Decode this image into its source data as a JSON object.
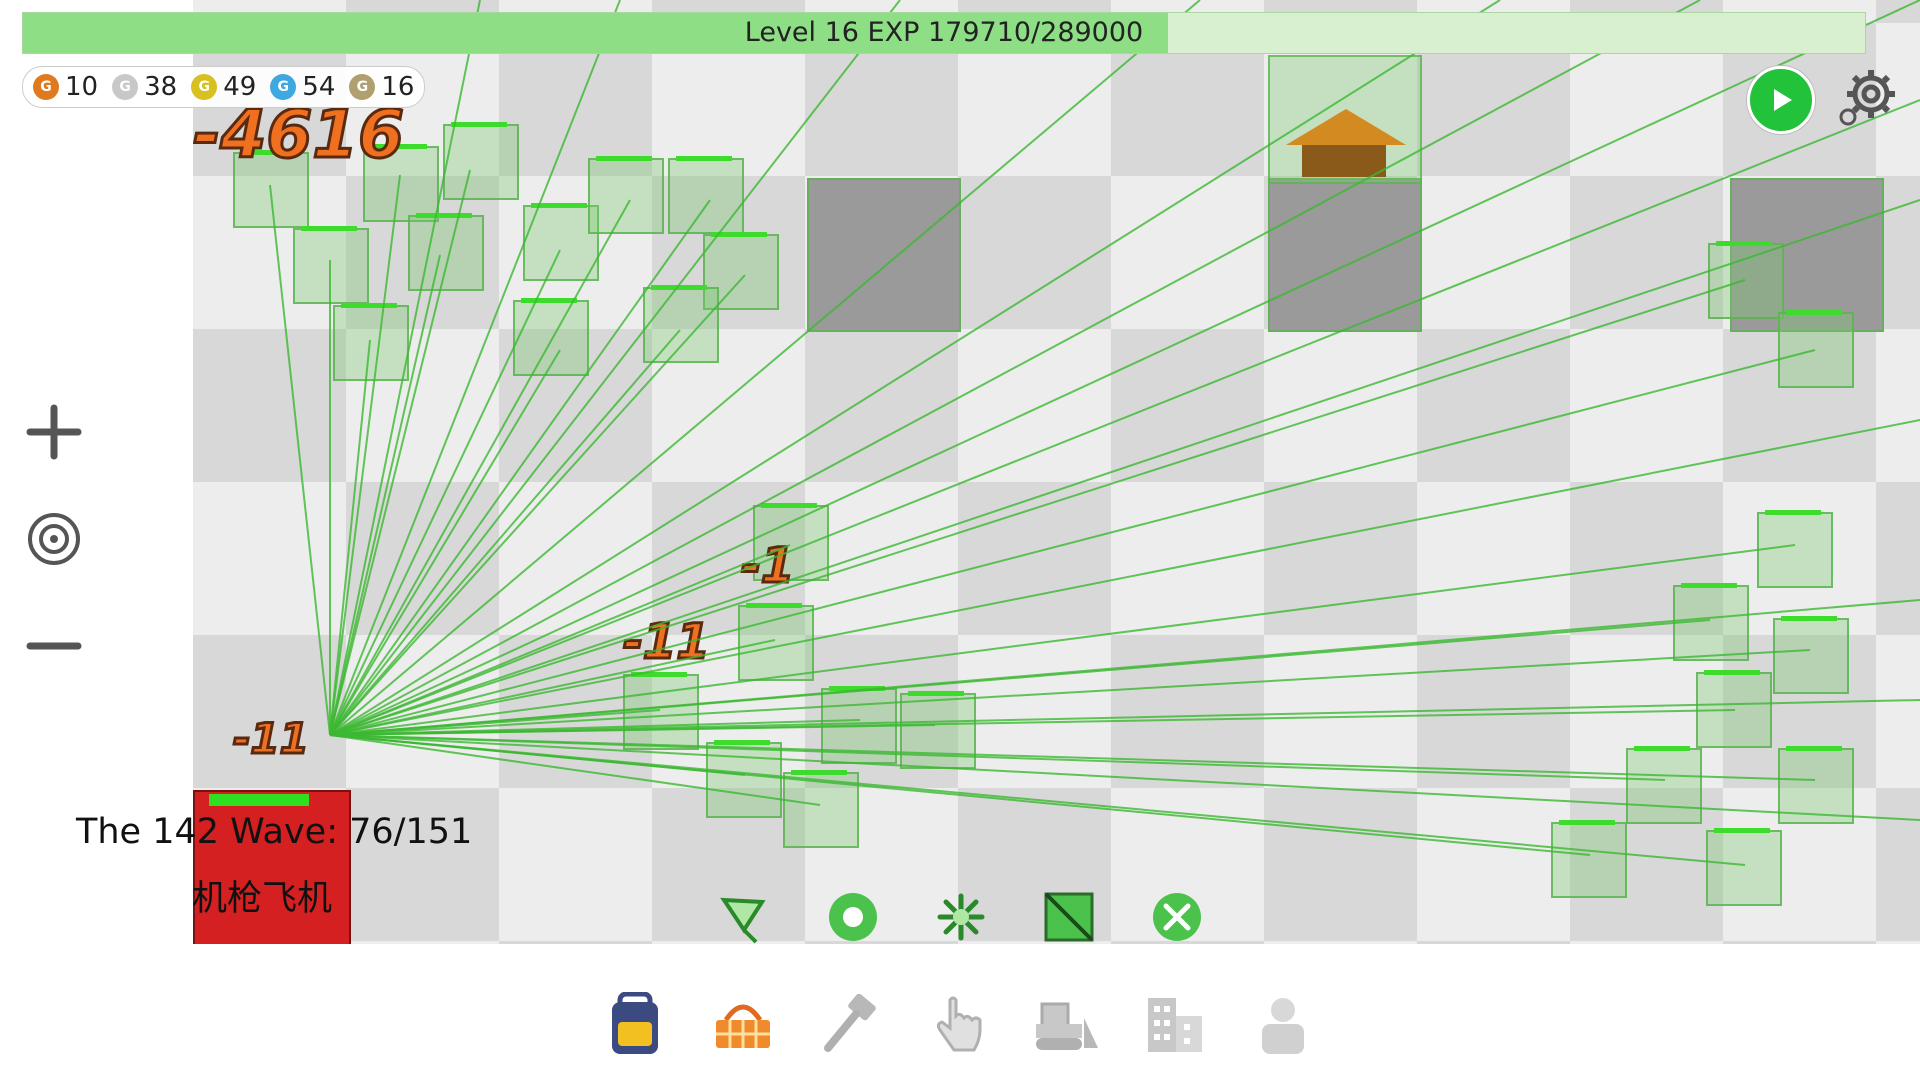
{
  "exp_bar": {
    "text": "Level 16 EXP 179710/289000",
    "progress": 0.6218
  },
  "resources": [
    {
      "icon": "bronze-coin-icon",
      "value": "10",
      "color": "#e07a20"
    },
    {
      "icon": "silver-coin-icon",
      "value": "38",
      "color": "#c8c8c8"
    },
    {
      "icon": "gold-coin-icon",
      "value": "49",
      "color": "#d8c020"
    },
    {
      "icon": "blue-coin-icon",
      "value": "54",
      "color": "#40a8e0"
    },
    {
      "icon": "olive-coin-icon",
      "value": "16",
      "color": "#b0a070"
    }
  ],
  "wave": {
    "label": "The 142 Wave: 76/151",
    "enemy_name": "机枪飞机"
  },
  "damage_numbers": [
    "-4616",
    "-1",
    "-11",
    "-11"
  ],
  "colors": {
    "laser": "#3cb832",
    "tower_fill": "#78c86e",
    "enemy_red": "#d42020",
    "play_button": "#22c23a"
  },
  "toolbar": [
    "select-tool-icon",
    "circle-tool-icon",
    "scatter-tool-icon",
    "square-tool-icon",
    "cancel-tool-icon"
  ],
  "bottom_nav": [
    "backpack-icon",
    "shop-basket-icon",
    "hammer-icon",
    "hand-pointer-icon",
    "bulldozer-icon",
    "buildings-icon",
    "profile-icon"
  ]
}
